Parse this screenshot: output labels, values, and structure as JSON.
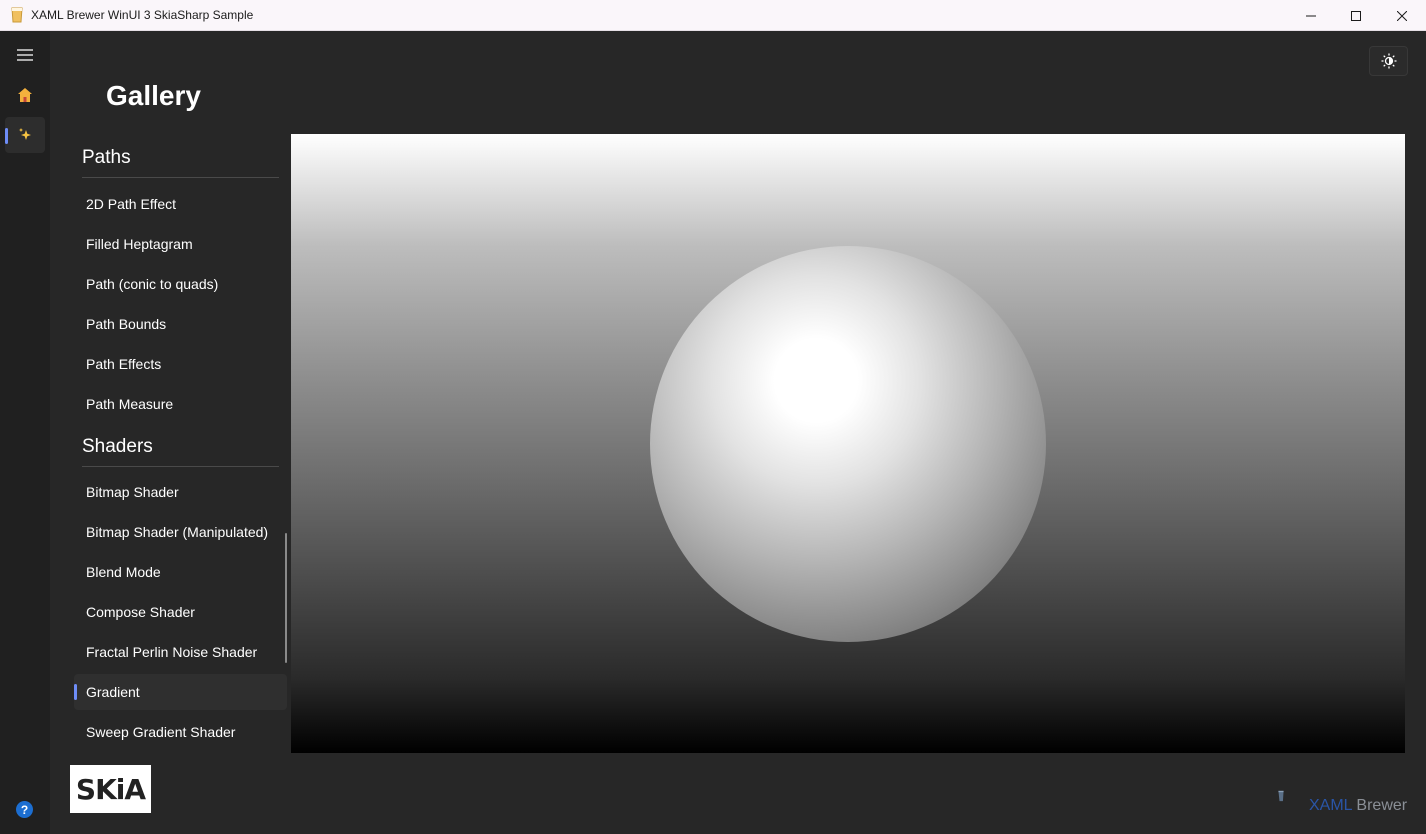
{
  "window": {
    "title": "XAML Brewer WinUI 3 SkiaSharp Sample"
  },
  "page": {
    "title": "Gallery"
  },
  "nav": {
    "selected": "gallery"
  },
  "gallery": {
    "groups": [
      {
        "header": "Paths",
        "items": [
          "2D Path Effect",
          "Filled Heptagram",
          "Path (conic to quads)",
          "Path Bounds",
          "Path Effects",
          "Path Measure"
        ]
      },
      {
        "header": "Shaders",
        "items": [
          "Bitmap Shader",
          "Bitmap Shader (Manipulated)",
          "Blend Mode",
          "Compose Shader",
          "Fractal Perlin Noise Shader",
          "Gradient",
          "Sweep Gradient Shader"
        ]
      }
    ],
    "selected_item": "Gradient"
  },
  "footer": {
    "logo_text": "SKiA",
    "help_glyph": "?",
    "brand_part1": "XAML",
    "brand_part2": " Brewer"
  },
  "colors": {
    "accent": "#6e8df7",
    "background": "#272727",
    "nav_background": "#202020",
    "brand_blue": "#2a55a6"
  },
  "icons": [
    "app-icon",
    "minimize-icon",
    "maximize-icon",
    "close-icon",
    "hamburger-menu-icon",
    "home-icon",
    "sparkle-icon",
    "theme-toggle-icon",
    "help-icon"
  ]
}
